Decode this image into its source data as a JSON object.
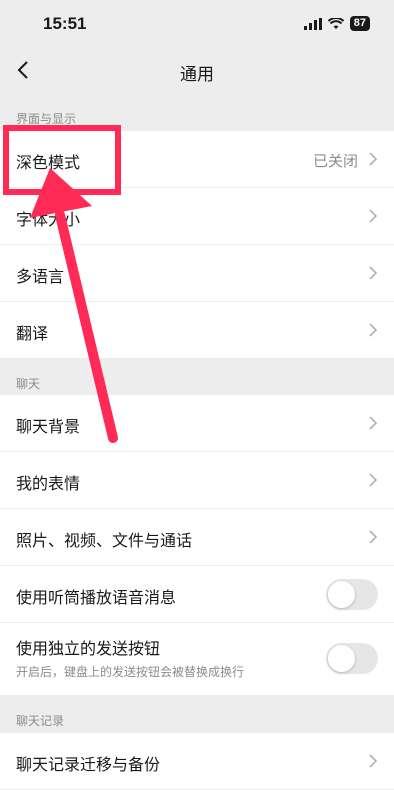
{
  "status": {
    "time": "15:51",
    "battery": "87"
  },
  "nav": {
    "title": "通用"
  },
  "sections": {
    "display": {
      "header": "界面与显示",
      "dark_mode": {
        "label": "深色模式",
        "value": "已关闭"
      },
      "font_size": {
        "label": "字体大小"
      },
      "language": {
        "label": "多语言"
      },
      "translate": {
        "label": "翻译"
      }
    },
    "chat": {
      "header": "聊天",
      "background": {
        "label": "聊天背景"
      },
      "stickers": {
        "label": "我的表情"
      },
      "media": {
        "label": "照片、视频、文件与通话"
      },
      "earpiece": {
        "label": "使用听筒播放语音消息",
        "enabled": false
      },
      "send_button": {
        "label": "使用独立的发送按钮",
        "sub": "开启后，键盘上的发送按钮会被替换成换行",
        "enabled": false
      }
    },
    "history": {
      "header": "聊天记录",
      "migrate": {
        "label": "聊天记录迁移与备份"
      }
    }
  },
  "colors": {
    "highlight": "#ff2a55",
    "background": "#ededed"
  }
}
